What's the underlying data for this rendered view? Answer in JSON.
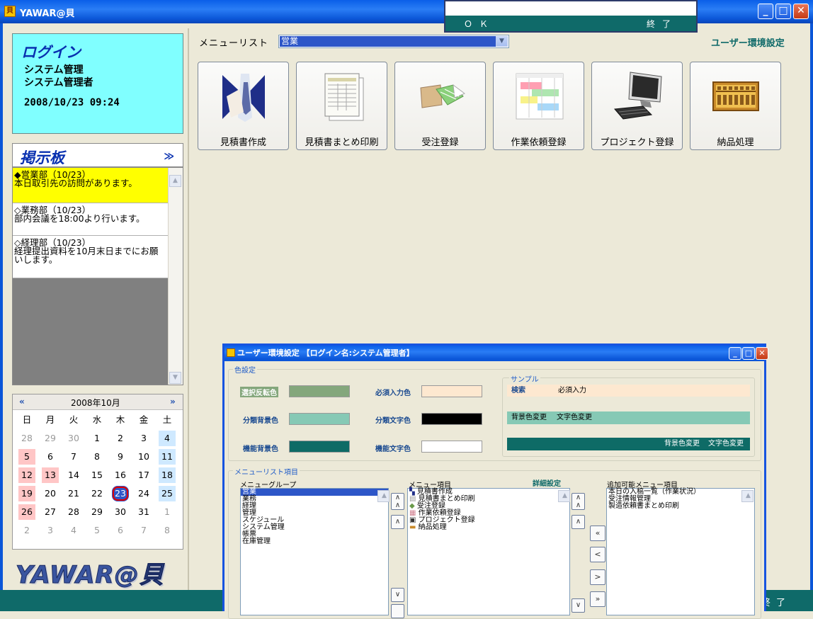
{
  "window": {
    "title": "YAWAR@貝",
    "app_icon_glyph": "貝"
  },
  "top_dialog": {
    "ok_label": "ＯＫ",
    "quit_label": "終了"
  },
  "login": {
    "title": "ログイン",
    "lines": [
      "システム管理",
      "システム管理者",
      "2008/10/23 09:24"
    ]
  },
  "bulletin": {
    "title": "掲示板",
    "more": "≫",
    "items": [
      {
        "head": "◆営業部（10/23）",
        "body": "本日取引先の訪問があります。",
        "highlight": true
      },
      {
        "head": "◇業務部（10/23）",
        "body": "部内会議を18:00より行います。",
        "highlight": false
      },
      {
        "head": "◇経理部（10/23）",
        "body": "経理提出資料を10月末日までにお願いします。",
        "highlight": false
      }
    ]
  },
  "calendar": {
    "prev": "«",
    "next": "»",
    "month_label": "2008年10月",
    "weekdays": [
      "日",
      "月",
      "火",
      "水",
      "木",
      "金",
      "土"
    ],
    "weeks": [
      [
        "28",
        "29",
        "30",
        "1",
        "2",
        "3",
        "4"
      ],
      [
        "5",
        "6",
        "7",
        "8",
        "9",
        "10",
        "11"
      ],
      [
        "12",
        "13",
        "14",
        "15",
        "16",
        "17",
        "18"
      ],
      [
        "19",
        "20",
        "21",
        "22",
        "23",
        "24",
        "25"
      ],
      [
        "26",
        "27",
        "28",
        "29",
        "30",
        "31",
        "1"
      ],
      [
        "2",
        "3",
        "4",
        "5",
        "6",
        "7",
        "8"
      ]
    ],
    "today": "23"
  },
  "logo": {
    "text": "YAWAR@貝"
  },
  "menu": {
    "label": "メニューリスト",
    "selected": "営業",
    "user_env_link": "ユーザー環境設定",
    "tiles": [
      {
        "label": "見積書作成",
        "icon": "businessman-icon"
      },
      {
        "label": "見積書まとめ印刷",
        "icon": "document-sheets-icon"
      },
      {
        "label": "受注登録",
        "icon": "order-transfer-icon"
      },
      {
        "label": "作業依頼登録",
        "icon": "gantt-chart-icon"
      },
      {
        "label": "プロジェクト登録",
        "icon": "computer-icon"
      },
      {
        "label": "納品処理",
        "icon": "abacus-icon"
      }
    ]
  },
  "env_dialog": {
    "title": "ユーザー環境設定 【ログイン名:システム管理者】",
    "color_group": "色設定",
    "sample_group": "サンプル",
    "colors": {
      "select_reverse": "選択反転色",
      "category_bg": "分類背景色",
      "function_bg": "機能背景色",
      "required_input": "必須入力色",
      "category_text": "分類文字色",
      "function_text": "機能文字色"
    },
    "swatches": {
      "select_reverse": "#84a77c",
      "category_bg": "#86c9b5",
      "function_bg": "#0e6b66",
      "required_input": "#fde8d0",
      "category_text": "#000000",
      "function_text": "#ffffff"
    },
    "sample": {
      "search": "検索",
      "required": "必須入力",
      "bg_change": "背景色変更",
      "text_change": "文字色変更"
    },
    "menu_list_group": "メニューリスト項目",
    "menu_group_label": "メニューグループ",
    "menu_item_label": "メニュー項目",
    "detail_link": "詳細設定",
    "addable_label": "追加可能メニュー項目",
    "groups": [
      "営業",
      "業務",
      "経理",
      "管理",
      "スケジュール",
      "システム管理",
      "帳票",
      "在庫管理"
    ],
    "items": [
      "見積書作成",
      "見積書まとめ印刷",
      "受注登録",
      "作業依頼登録",
      "プロジェクト登録",
      "納品処理"
    ],
    "addable": [
      "本日の入稿一覧（作業状況）",
      "受注情報管理",
      "製造依頼書まとめ印刷"
    ]
  },
  "bottom": {
    "quit_label": "終了"
  }
}
